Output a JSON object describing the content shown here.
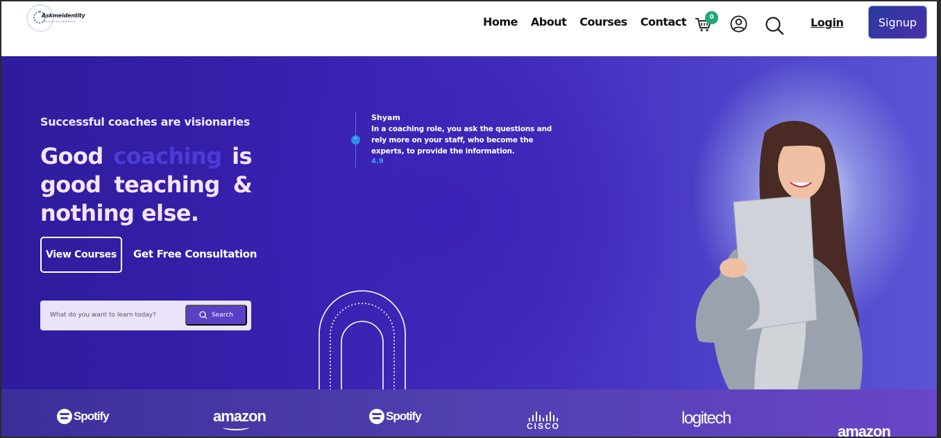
{
  "header": {
    "logo": {
      "name": "Askmeidentity",
      "tagline": "Safe-Guard Your Digital Frontier"
    },
    "nav": [
      "Home",
      "About",
      "Courses",
      "Contact"
    ],
    "cart_count": "0",
    "login_label": "Login",
    "signup_label": "Signup"
  },
  "hero": {
    "tagline": "Successful coaches are visionaries",
    "headline": {
      "line1_a": "Good",
      "line1_highlight": "coaching",
      "line1_b": "is",
      "line2": [
        "good",
        "teaching",
        "&"
      ],
      "line3": "nothing else."
    },
    "view_courses_label": "View Courses",
    "consult_label": "Get Free Consultation",
    "search": {
      "placeholder": "What do you want to learn today?",
      "button_label": "Search"
    },
    "testimonial": {
      "name": "Shyam",
      "text": "In a coaching role, you ask the questions and rely more on your staff, who become the experts, to provide the information.",
      "rating": "4.9"
    }
  },
  "brands": [
    "Spotify",
    "amazon",
    "Spotify",
    "CISCO",
    "logitech",
    "amazon"
  ],
  "colors": {
    "accent": "#5b3fc4",
    "highlight": "#4b3cd6",
    "signup_bg": "#2a3aa0",
    "badge": "#20a87a"
  }
}
